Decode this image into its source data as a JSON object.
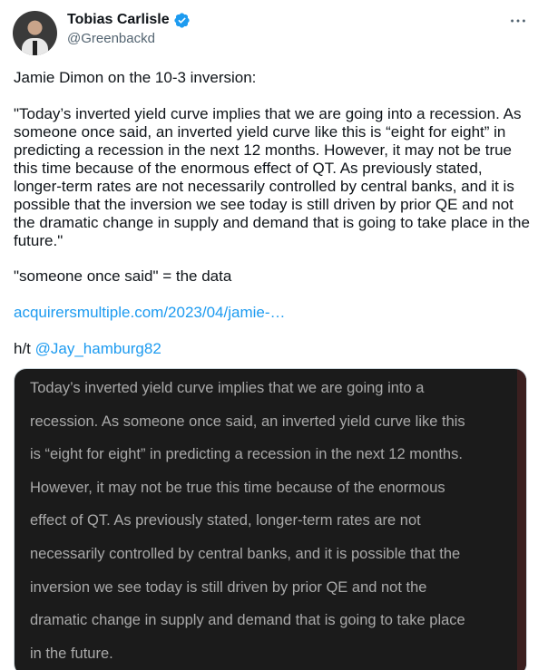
{
  "author": {
    "name": "Tobias Carlisle",
    "handle": "@Greenbackd",
    "verified_icon": "verified-badge-icon",
    "verified_color": "#1d9bf0"
  },
  "tweet": {
    "line1": "Jamie Dimon on the 10-3 inversion:",
    "quote": "\"Today’s inverted yield curve implies that we are going into a recession. As someone once said, an inverted yield curve like this is “eight for eight” in predicting a recession in the next 12 months. However, it may not be true this time because of the enormous effect of QT. As previously stated, longer-term rates are not necessarily controlled by central banks, and it is possible that the inversion we see today is still driven by prior QE and not the dramatic change in supply and demand that is going to take place in the future.\"",
    "line3": "\"someone once said\" = the data",
    "url_text": "acquirersmultiple.com/2023/04/jamie-…",
    "hat_tip_prefix": "h/t ",
    "mention": "@Jay_hamburg82"
  },
  "media": {
    "lines": [
      "Today’s inverted yield curve implies that we are going into a",
      "recession. As someone once said, an inverted yield curve like this",
      "is “eight for eight” in predicting a recession in the next 12 months.",
      "However, it may not be true this time because of the enormous",
      "effect of QT. As previously stated, longer-term rates are not",
      "necessarily controlled by central banks, and it is possible that the",
      "inversion we see today is still driven by prior QE and not the",
      "dramatic change in supply and demand that is going to take place",
      "in the future."
    ]
  },
  "colors": {
    "link": "#1d9bf0",
    "text": "#0f1419",
    "secondary": "#536471",
    "media_bg": "#1b1b1b",
    "media_text": "#a9a9a9"
  }
}
